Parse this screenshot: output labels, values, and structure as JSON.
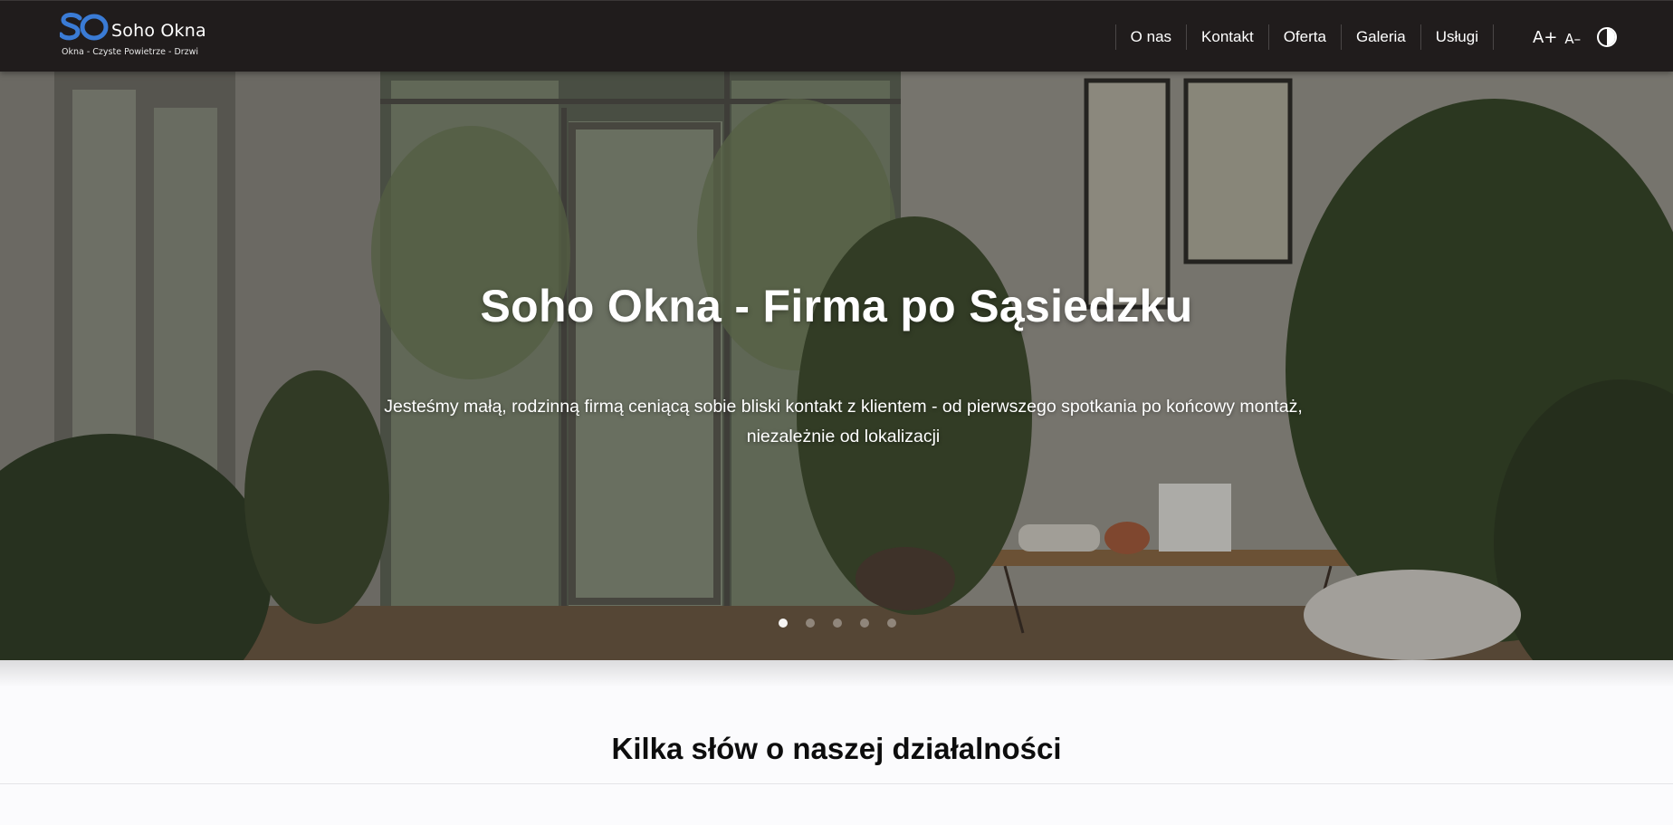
{
  "brand": {
    "name": "Soho Okna",
    "tagline": "Okna - Czyste Powietrze - Drzwi",
    "logo_letters": "SO",
    "logo_color": "#3a7bd5"
  },
  "nav": {
    "items": [
      {
        "label": "O nas"
      },
      {
        "label": "Kontakt"
      },
      {
        "label": "Oferta"
      },
      {
        "label": "Galeria"
      },
      {
        "label": "Usługi"
      }
    ]
  },
  "accessibility": {
    "font_increase": "A+",
    "font_decrease": "A–",
    "contrast_icon": "contrast-icon"
  },
  "hero": {
    "title": "Soho Okna - Firma po Sąsiedzku",
    "text": "Jesteśmy małą, rodzinną firmą ceniącą sobie bliski kontakt z klientem - od pierwszego spotkania po końcowy montaż, niezależnie od lokalizacji",
    "carousel": {
      "slide_count": 5,
      "active_slide": 1
    }
  },
  "about": {
    "title": "Kilka słów o naszej działalności"
  },
  "colors": {
    "navbar_bg": "#201c1c",
    "page_bg": "#fbfbfd",
    "text_light": "#ffffff"
  }
}
